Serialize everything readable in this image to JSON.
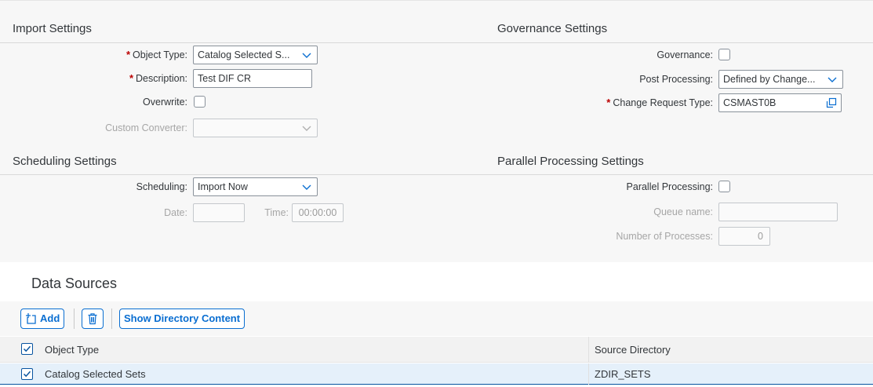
{
  "import_settings": {
    "title": "Import Settings",
    "object_type_label": "Object Type:",
    "object_type_value": "Catalog Selected S...",
    "description_label": "Description:",
    "description_value": "Test DIF CR",
    "overwrite_label": "Overwrite:",
    "overwrite_checked": false,
    "custom_converter_label": "Custom Converter:",
    "custom_converter_value": ""
  },
  "governance_settings": {
    "title": "Governance Settings",
    "governance_label": "Governance:",
    "governance_checked": false,
    "post_processing_label": "Post Processing:",
    "post_processing_value": "Defined by Change...",
    "change_request_type_label": "Change Request Type:",
    "change_request_type_value": "CSMAST0B"
  },
  "scheduling_settings": {
    "title": "Scheduling Settings",
    "scheduling_label": "Scheduling:",
    "scheduling_value": "Import Now",
    "date_label": "Date:",
    "date_value": "",
    "time_label": "Time:",
    "time_value": "00:00:00"
  },
  "parallel_settings": {
    "title": "Parallel Processing Settings",
    "parallel_processing_label": "Parallel Processing:",
    "parallel_processing_checked": false,
    "queue_name_label": "Queue name:",
    "queue_name_value": "",
    "num_processes_label": "Number of Processes:",
    "num_processes_value": "0"
  },
  "data_sources": {
    "title": "Data Sources",
    "toolbar": {
      "add_label": "Add",
      "delete_icon": "trash-icon",
      "show_dir_label": "Show Directory Content"
    },
    "columns": [
      "Object Type",
      "Source Directory"
    ],
    "rows": [
      {
        "object_type": "Catalog Selected Sets",
        "source_directory": "ZDIR_SETS",
        "selected": true
      }
    ]
  },
  "colors": {
    "accent": "#0a6ed1",
    "required": "#bb0000",
    "panel_bg": "#f7f7f7",
    "selected_row": "#e5f0fa"
  }
}
